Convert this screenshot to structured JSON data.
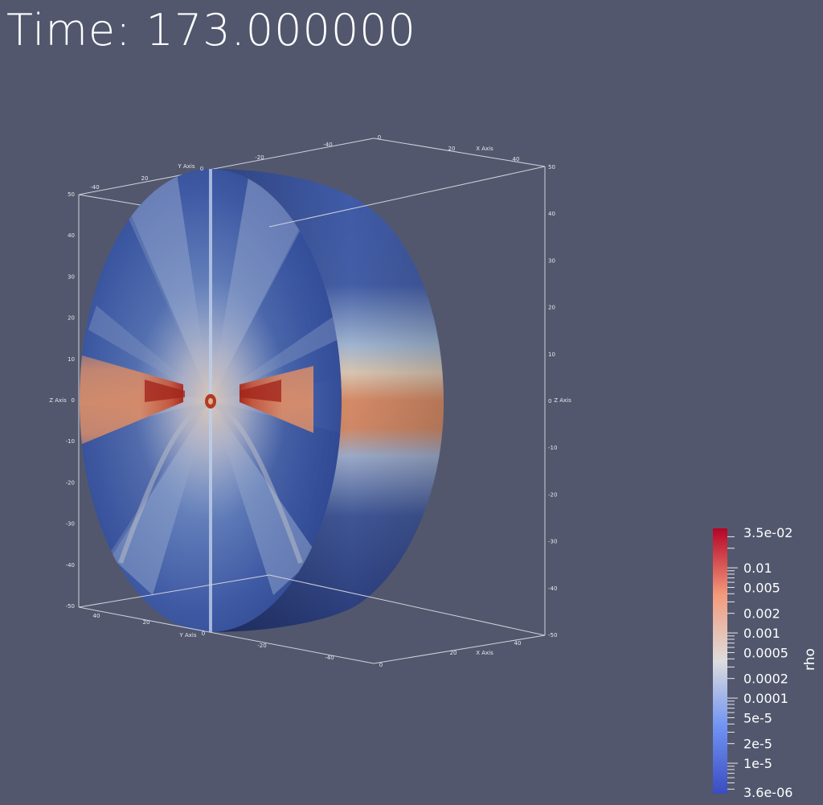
{
  "time_label": "Time: 173.000000",
  "axes": {
    "x_title": "X Axis",
    "y_title": "Y Axis",
    "z_title": "Z Axis",
    "z_left_ticks": [
      "50",
      "40",
      "30",
      "20",
      "10",
      "0",
      "-10",
      "-20",
      "-30",
      "-40",
      "-50"
    ],
    "z_right_ticks": [
      "50",
      "40",
      "30",
      "20",
      "10",
      "0",
      "-10",
      "-20",
      "-30",
      "-40",
      "-50"
    ],
    "top_ticks": [
      "-40",
      "20",
      "0",
      "-20",
      "-40",
      "0",
      "20",
      "40"
    ],
    "bottom_ticks": [
      "40",
      "20",
      "0",
      "-20",
      "-40",
      "0",
      "20",
      "40"
    ]
  },
  "colorbar": {
    "title": "rho",
    "scale": "log",
    "range": [
      3.6e-06,
      0.035
    ],
    "colors": {
      "low": "#3b4cc0",
      "mid": "#dddddd",
      "high": "#b40426"
    },
    "labels": [
      {
        "text": "3.5e-02",
        "value": 0.035
      },
      {
        "text": "0.01",
        "value": 0.01
      },
      {
        "text": "0.005",
        "value": 0.005
      },
      {
        "text": "0.002",
        "value": 0.002
      },
      {
        "text": "0.001",
        "value": 0.001
      },
      {
        "text": "0.0005",
        "value": 0.0005
      },
      {
        "text": "0.0002",
        "value": 0.0002
      },
      {
        "text": "0.0001",
        "value": 0.0001
      },
      {
        "text": "5e-5",
        "value": 5e-05
      },
      {
        "text": "2e-5",
        "value": 2e-05
      },
      {
        "text": "1e-5",
        "value": 1e-05
      },
      {
        "text": "3.6e-06",
        "value": 3.6e-06
      }
    ]
  }
}
